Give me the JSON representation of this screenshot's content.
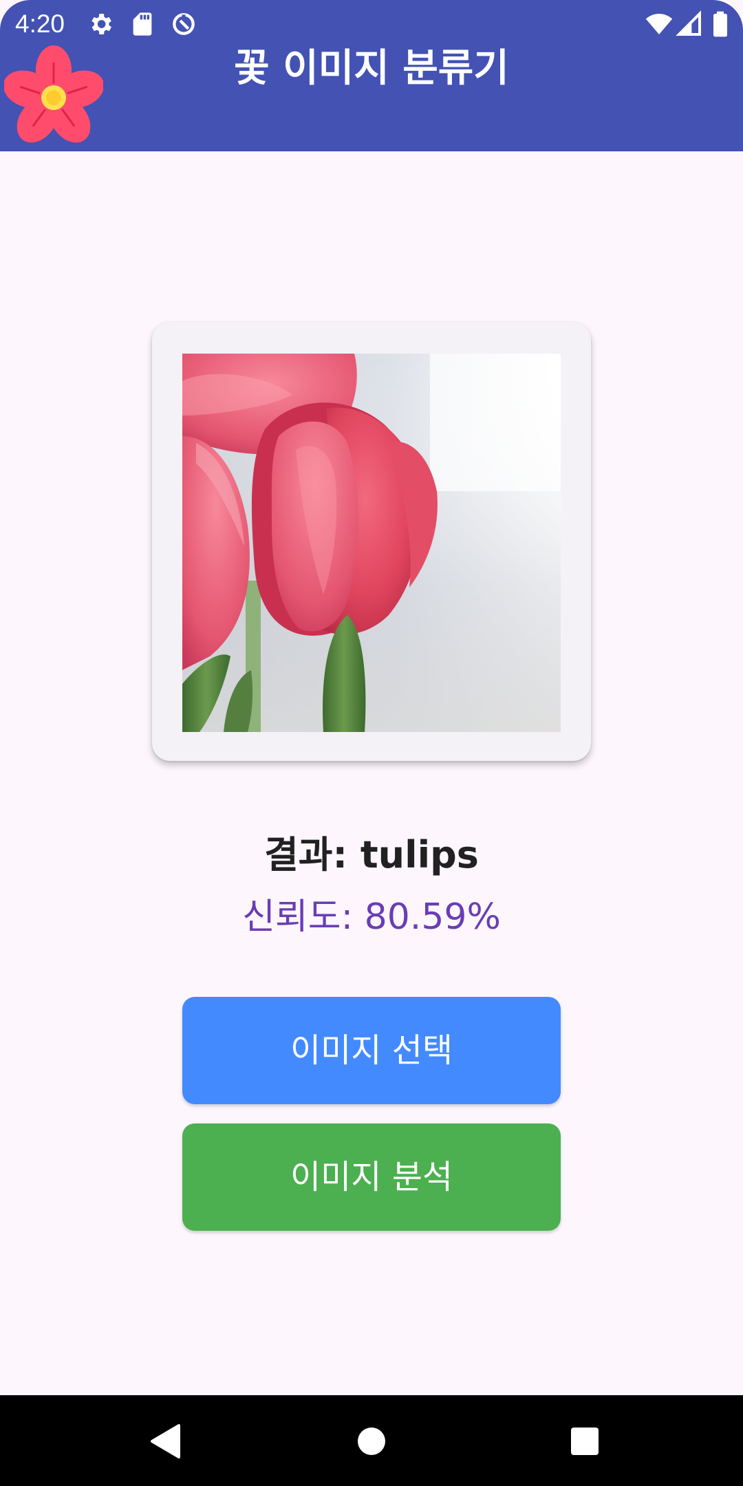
{
  "status_bar": {
    "time": "4:20",
    "icons": [
      "settings-gear-icon",
      "sd-card-icon",
      "data-saver-icon",
      "wifi-icon",
      "cellular-signal-icon",
      "battery-icon"
    ]
  },
  "app_bar": {
    "title": "꽃 이미지 분류기",
    "logo": "flower-logo-icon",
    "color": "#4352B3"
  },
  "main": {
    "image_card": {
      "image": "pink-tulips-photo"
    },
    "result_text": "결과: tulips",
    "confidence_text": "신뢰도: 80.59%",
    "confidence_color": "#6A3DB3"
  },
  "buttons": {
    "select_label": "이미지 선택",
    "select_color": "#448AFF",
    "analyze_label": "이미지 분석",
    "analyze_color": "#4CAF50"
  },
  "nav_bar": {
    "icons": [
      "back-icon",
      "home-icon",
      "recents-icon"
    ]
  }
}
